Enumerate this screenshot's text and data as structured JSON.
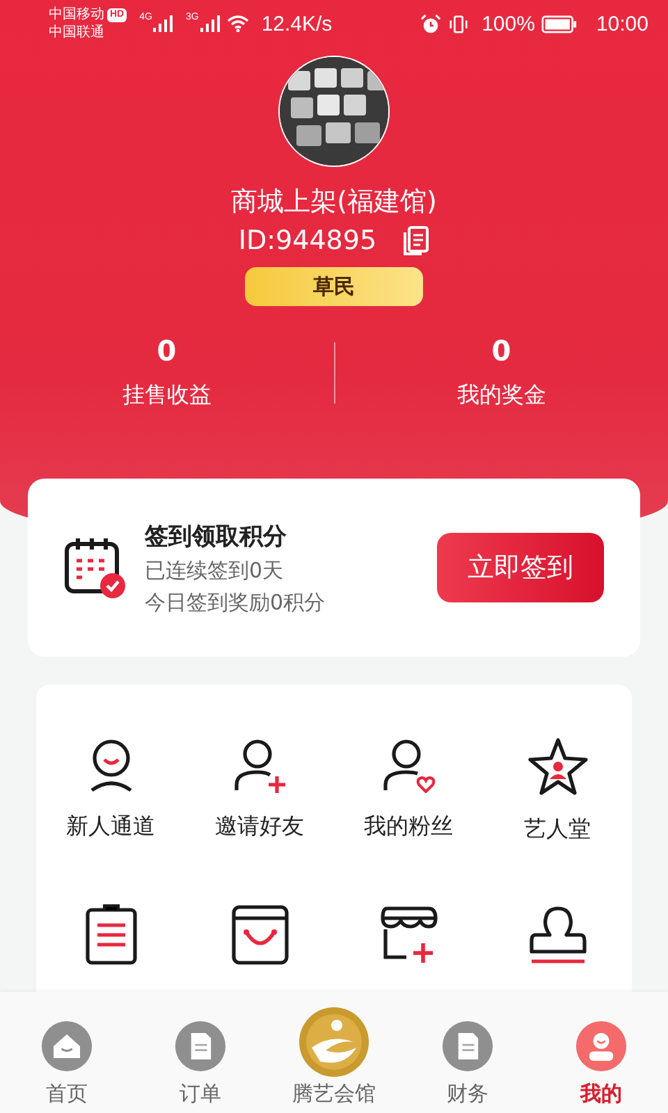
{
  "status_bar": {
    "carrier_1": "中国移动",
    "hd_badge": "HD",
    "carrier_2": "中国联通",
    "net_1": "4G",
    "net_2": "3G",
    "speed": "12.4K/s",
    "battery": "100%",
    "time": "10:00"
  },
  "profile": {
    "name": "商城上架(福建馆)",
    "id": "ID:944895",
    "level_badge": "草民"
  },
  "stats": [
    {
      "value": "0",
      "label": "挂售收益"
    },
    {
      "value": "0",
      "label": "我的奖金"
    }
  ],
  "checkin": {
    "title": "签到领取积分",
    "streak": "已连续签到0天",
    "reward": "今日签到奖励0积分",
    "button": "立即签到"
  },
  "features": [
    {
      "kind": "smile",
      "label": "新人通道"
    },
    {
      "kind": "invite",
      "label": "邀请好友"
    },
    {
      "kind": "fans",
      "label": "我的粉丝"
    },
    {
      "kind": "star",
      "label": "艺人堂"
    },
    {
      "kind": "clipboard"
    },
    {
      "kind": "bag"
    },
    {
      "kind": "store"
    },
    {
      "kind": "stamp"
    }
  ],
  "tabs": [
    {
      "kind": "home",
      "label": "首页",
      "selected": false
    },
    {
      "kind": "doc",
      "label": "订单",
      "selected": false
    },
    {
      "kind": "logo",
      "label": "腾艺会馆",
      "selected": false
    },
    {
      "kind": "doc",
      "label": "财务",
      "selected": false
    },
    {
      "kind": "user",
      "label": "我的",
      "selected": true
    }
  ]
}
